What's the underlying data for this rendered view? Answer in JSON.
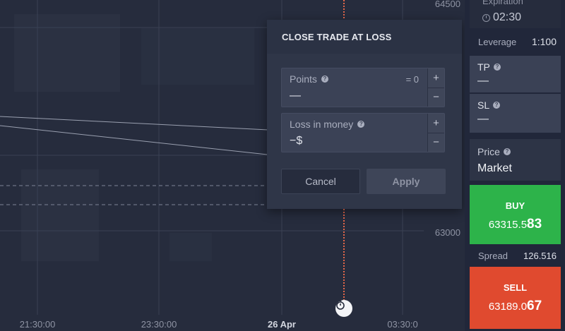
{
  "chart": {
    "price_labels": [
      "64500",
      "63000"
    ],
    "time_labels": [
      "21:30:00",
      "23:30:00",
      "26 Apr",
      "03:30:0"
    ]
  },
  "dialog": {
    "title": "CLOSE TRADE AT LOSS",
    "points": {
      "label": "Points",
      "value": "—",
      "right": "= 0"
    },
    "money": {
      "label": "Loss in money",
      "value": "−$"
    },
    "stepper_plus": "+",
    "stepper_minus": "−",
    "help_glyph": "?",
    "cancel_label": "Cancel",
    "apply_label": "Apply"
  },
  "panel": {
    "expiration_label": "Expiration",
    "expiration_value": "02:30",
    "leverage_label": "Leverage",
    "leverage_value": "1:100",
    "tp_label": "TP",
    "tp_value": "—",
    "sl_label": "SL",
    "sl_value": "—",
    "price_label": "Price",
    "price_value": "Market",
    "buy_label": "BUY",
    "buy_price_main": "63315.5",
    "buy_price_big": "83",
    "spread_label": "Spread",
    "spread_value": "126.516",
    "sell_label": "SELL",
    "sell_price_main": "63189.0",
    "sell_price_big": "67"
  },
  "colors": {
    "buy": "#2db34a",
    "sell": "#e04a2f",
    "marker_line": "#e05a3a"
  }
}
